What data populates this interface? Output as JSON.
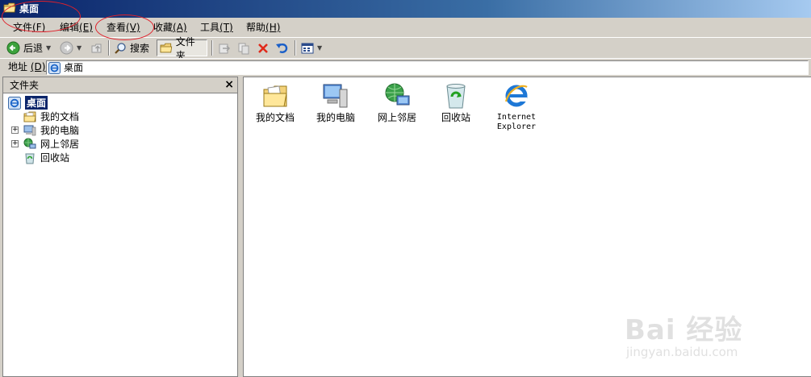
{
  "window": {
    "title": "桌面"
  },
  "menubar": {
    "items": [
      {
        "label": "文件",
        "key": "(F)"
      },
      {
        "label": "编辑",
        "key": "(E)"
      },
      {
        "label": "查看",
        "key": "(V)"
      },
      {
        "label": "收藏",
        "key": "(A)"
      },
      {
        "label": "工具",
        "key": "(T)"
      },
      {
        "label": "帮助",
        "key": "(H)"
      }
    ]
  },
  "toolbar": {
    "back_label": "后退",
    "search_label": "搜索",
    "folders_label": "文件夹"
  },
  "address": {
    "label": "地址",
    "key": "(D)",
    "value": "桌面"
  },
  "folders_pane": {
    "title": "文件夹",
    "close_glyph": "×",
    "tree": [
      {
        "label": "桌面",
        "icon": "desktop-icon",
        "selected": true
      },
      {
        "label": "我的文档",
        "icon": "my-documents-icon"
      },
      {
        "label": "我的电脑",
        "icon": "my-computer-icon",
        "expandable": true
      },
      {
        "label": "网上邻居",
        "icon": "network-places-icon",
        "expandable": true
      },
      {
        "label": "回收站",
        "icon": "recycle-bin-icon"
      }
    ]
  },
  "desktop_items": [
    {
      "label": "我的文档",
      "icon": "my-documents-icon"
    },
    {
      "label": "我的电脑",
      "icon": "my-computer-icon"
    },
    {
      "label": "网上邻居",
      "icon": "network-places-icon"
    },
    {
      "label": "回收站",
      "icon": "recycle-bin-icon"
    },
    {
      "label_line1": "Internet",
      "label_line2": "Explorer",
      "icon": "internet-explorer-icon"
    }
  ],
  "watermark": {
    "text": "Bai 经验",
    "sub": "jingyan.baidu.com"
  },
  "colors": {
    "titlebar": "#0a246a",
    "selection": "#0a246a",
    "annotation": "#e0202a",
    "chrome": "#d4d0c8"
  }
}
